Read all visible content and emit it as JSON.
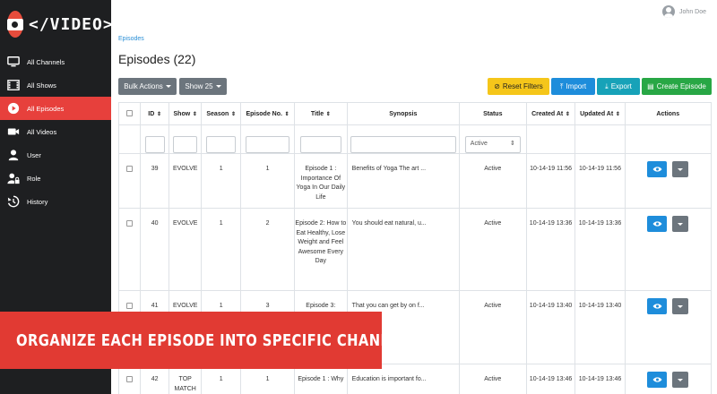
{
  "app": {
    "logo_text": "</VIDEO>"
  },
  "user": {
    "name": "John Doe"
  },
  "sidebar": {
    "items": [
      {
        "label": "All Channels",
        "icon": "monitor-icon"
      },
      {
        "label": "All Shows",
        "icon": "film-icon"
      },
      {
        "label": "All Episodes",
        "icon": "play-circle-icon",
        "active": true
      },
      {
        "label": "All Videos",
        "icon": "video-camera-icon"
      },
      {
        "label": "User",
        "icon": "user-icon"
      },
      {
        "label": "Role",
        "icon": "user-lock-icon"
      },
      {
        "label": "History",
        "icon": "history-icon"
      }
    ]
  },
  "breadcrumb": "Episodes",
  "page_title": "Episodes (22)",
  "toolbar": {
    "bulk_actions": "Bulk Actions",
    "show": "Show 25",
    "reset_filters": "Reset Filters",
    "import": "Import",
    "export": "Export",
    "create_episode": "Create Episode"
  },
  "table": {
    "columns": [
      "ID",
      "Show",
      "Season",
      "Episode No.",
      "Title",
      "Synopsis",
      "Status",
      "Created At",
      "Updated At",
      "Actions"
    ],
    "status_filter": "Active",
    "rows": [
      {
        "id": "39",
        "show": "EVOLVE",
        "season": "1",
        "episode": "1",
        "title": "Episode 1 : Importance Of Yoga In Our Daily Life",
        "synopsis": "Benefits of Yoga The art ...",
        "status": "Active",
        "created": "10-14-19 11:56",
        "updated": "10-14-19 11:56"
      },
      {
        "id": "40",
        "show": "EVOLVE",
        "season": "1",
        "episode": "2",
        "title": "Episode 2: How to Eat Healthy, Lose Weight and Feel Awesome Every Day",
        "synopsis": "You should eat natural, u...",
        "status": "Active",
        "created": "10-14-19 13:36",
        "updated": "10-14-19 13:36"
      },
      {
        "id": "41",
        "show": "EVOLVE",
        "season": "1",
        "episode": "3",
        "title": "Episode 3:",
        "synopsis": "That you can get by on f...",
        "status": "Active",
        "created": "10-14-19 13:40",
        "updated": "10-14-19 13:40"
      },
      {
        "id": "42",
        "show": "TOP MATCH",
        "season": "1",
        "episode": "1",
        "title": "Episode 1 : Why",
        "synopsis": "Education is important fo...",
        "status": "Active",
        "created": "10-14-19 13:46",
        "updated": "10-14-19 13:46"
      }
    ]
  },
  "banner": "ORGANIZE EACH EPISODE INTO SPECIFIC CHANNELS",
  "colors": {
    "accent": "#e7403c",
    "sidebar": "#1e1f21",
    "primary": "#1e8ddb",
    "warning": "#f5c61a",
    "success": "#28a745",
    "info": "#17a2b8"
  }
}
